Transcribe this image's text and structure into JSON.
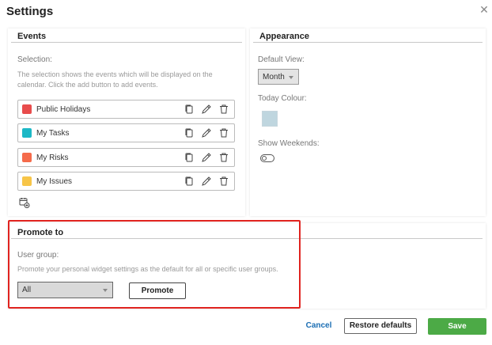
{
  "dialog": {
    "title": "Settings",
    "close_icon": "close-icon"
  },
  "events": {
    "header": "Events",
    "selection_label": "Selection:",
    "description": "The selection shows the events which will be displayed on the calendar. Click the add button to add events.",
    "items": [
      {
        "label": "Public Holidays",
        "color": "#e84c4c"
      },
      {
        "label": "My Tasks",
        "color": "#1cb8c6"
      },
      {
        "label": "My Risks",
        "color": "#f56b4b"
      },
      {
        "label": "My Issues",
        "color": "#f7c548"
      }
    ],
    "row_icons": [
      "copy-icon",
      "edit-icon",
      "delete-icon"
    ],
    "add_icon": "add-calendar-icon"
  },
  "appearance": {
    "header": "Appearance",
    "default_view_label": "Default View:",
    "default_view_value": "Month",
    "today_colour_label": "Today Colour:",
    "today_colour": "#bfd6df",
    "show_weekends_label": "Show Weekends:",
    "show_weekends_on": false
  },
  "promote": {
    "header": "Promote to",
    "user_group_label": "User group:",
    "description": "Promote your personal widget settings as the default for all or specific user groups.",
    "select_value": "All",
    "button_label": "Promote"
  },
  "footer": {
    "cancel_label": "Cancel",
    "restore_label": "Restore defaults",
    "save_label": "Save",
    "save_color": "#4caa46"
  },
  "highlight_color": "#e0231f"
}
